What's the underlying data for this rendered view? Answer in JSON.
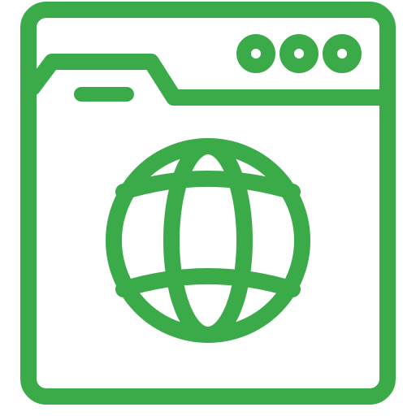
{
  "icon": {
    "name": "browser-window-globe-icon",
    "style": "outline",
    "colors": {
      "stroke": "#3bab4a",
      "background": "#ffffff"
    },
    "elements": {
      "window": "browser-window-frame",
      "tab": "folder-tab",
      "title_dash": "tab-title-bar",
      "control_dots": [
        "window-control-dot",
        "window-control-dot",
        "window-control-dot"
      ],
      "globe": "globe-icon"
    }
  }
}
